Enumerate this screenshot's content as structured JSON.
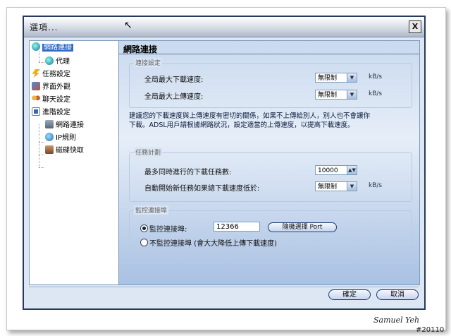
{
  "window": {
    "title": "選項...",
    "close_glyph": "X"
  },
  "nav": {
    "items": [
      {
        "label": "網路連接",
        "selected": true,
        "icon": "globe-icon"
      },
      {
        "label": "代理",
        "icon": "globe-icon"
      },
      {
        "label": "任務設定",
        "icon": "lightning-icon"
      },
      {
        "label": "界面外觀",
        "icon": "paint-icon"
      },
      {
        "label": "聊天設定",
        "icon": "chat-users-icon"
      },
      {
        "label": "進階設定",
        "icon": "advanced-settings-icon"
      },
      {
        "label": "網路連接",
        "icon": "network-computers-icon"
      },
      {
        "label": "IP規則",
        "icon": "ip-rule-icon"
      },
      {
        "label": "磁碟快取",
        "icon": "disk-cache-icon"
      }
    ]
  },
  "main": {
    "heading": "網路連接",
    "connection": {
      "title": "連接設定",
      "max_download_label": "全局最大下載速度:",
      "max_download_value": "無限制",
      "max_upload_label": "全局最大上傳速度:",
      "max_upload_value": "無限制",
      "unit": "kB/s"
    },
    "note_line1": "建議您的下載速度與上傳速度有密切的關係，如果不上傳給別人，別人也不會讓你",
    "note_line2": "下載。ADSL用戶請根據網路狀況，設定適當的上傳速度，以提高下載速度。",
    "tasks": {
      "title": "任務計劃",
      "max_tasks_label": "最多同時進行的下載任務數:",
      "max_tasks_value": "10000",
      "auto_start_label": "自動開始新任務如果總下載速度低於:",
      "auto_start_value": "無限制",
      "unit": "kB/s"
    },
    "listen": {
      "title": "監控連接埠",
      "listen_label": "監控連接埠:",
      "port_value": "12366",
      "random_button": "隨機選擇 Port",
      "no_listen_label": "不監控連接埠 (會大大降低上傳下載速度)",
      "listen_selected": true
    }
  },
  "footer": {
    "ok_label": "確定",
    "cancel_label": "取消"
  },
  "watermark": {
    "signature": "Samuel Yeh",
    "version": "#20110"
  }
}
